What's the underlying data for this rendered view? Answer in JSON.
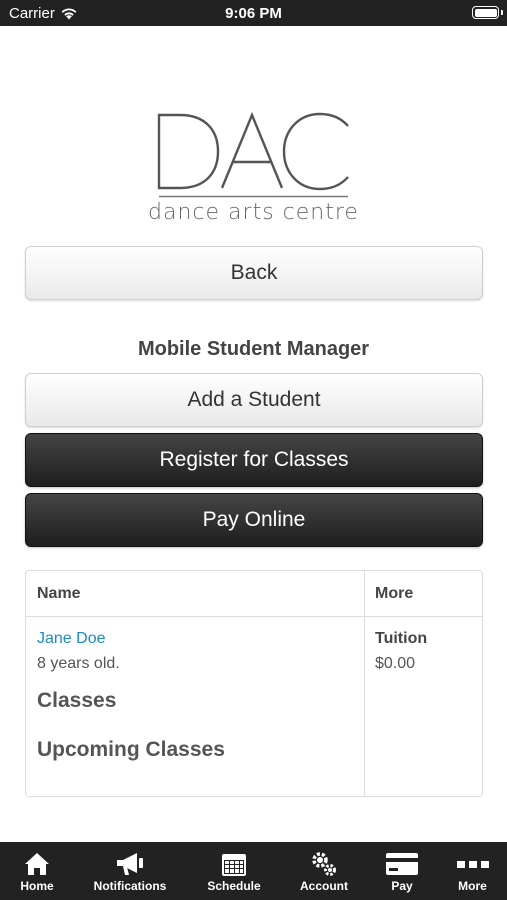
{
  "status_bar": {
    "carrier": "Carrier",
    "time": "9:06 PM"
  },
  "logo": {
    "letters": "DAC",
    "tagline": "dance arts centre"
  },
  "buttons": {
    "back": "Back",
    "add_student": "Add a Student",
    "register": "Register for Classes",
    "pay_online": "Pay Online"
  },
  "section_title": "Mobile Student Manager",
  "table": {
    "headers": {
      "name": "Name",
      "more": "More"
    },
    "student": {
      "name": "Jane Doe",
      "age": "8 years old.",
      "classes_heading": "Classes",
      "upcoming_heading": "Upcoming Classes",
      "more_label": "Tuition",
      "more_value": "$0.00"
    }
  },
  "tab_bar": [
    {
      "label": "Home",
      "icon": "home-icon"
    },
    {
      "label": "Notifications",
      "icon": "megaphone-icon"
    },
    {
      "label": "Schedule",
      "icon": "calendar-icon"
    },
    {
      "label": "Account",
      "icon": "gears-icon"
    },
    {
      "label": "Pay",
      "icon": "credit-card-icon"
    },
    {
      "label": "More",
      "icon": "more-dots-icon"
    }
  ],
  "colors": {
    "status_bar_bg": "#222222",
    "tab_bar_bg": "#222222",
    "link": "#1a8bc7",
    "dark_button": "#2a2a2a"
  }
}
